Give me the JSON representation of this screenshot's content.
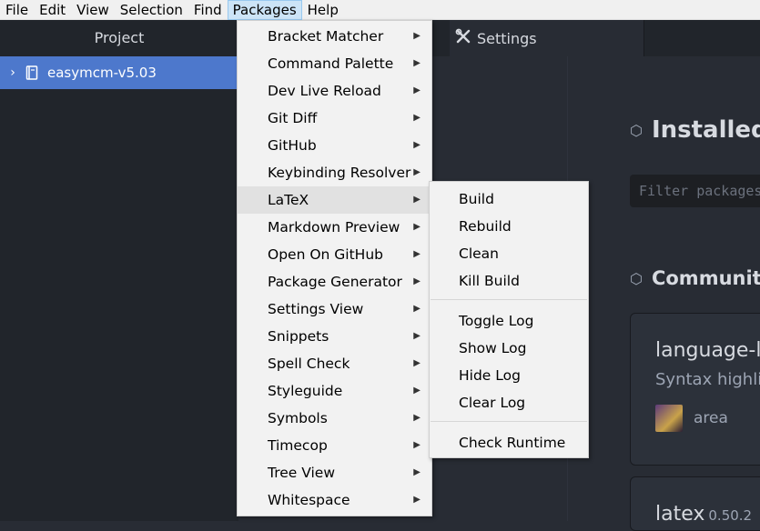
{
  "menubar": {
    "items": [
      "File",
      "Edit",
      "View",
      "Selection",
      "Find",
      "Packages",
      "Help"
    ],
    "active": "Packages"
  },
  "tree": {
    "header": "Project",
    "root_label": "easymcm-v5.03"
  },
  "tabs": {
    "settings_label": "Settings"
  },
  "settings": {
    "installed_title": "Installed",
    "filter_placeholder": "Filter packages",
    "community_title": "Community",
    "card1": {
      "name": "language-la",
      "desc": "Syntax highlig",
      "author": "area"
    },
    "card2": {
      "name": "latex",
      "version": "0.50.2"
    }
  },
  "packages_menu": {
    "items": [
      "Bracket Matcher",
      "Command Palette",
      "Dev Live Reload",
      "Git Diff",
      "GitHub",
      "Keybinding Resolver",
      "LaTeX",
      "Markdown Preview",
      "Open On GitHub",
      "Package Generator",
      "Settings View",
      "Snippets",
      "Spell Check",
      "Styleguide",
      "Symbols",
      "Timecop",
      "Tree View",
      "Whitespace"
    ],
    "highlighted": "LaTeX"
  },
  "latex_menu": {
    "group1": [
      "Build",
      "Rebuild",
      "Clean",
      "Kill Build"
    ],
    "group2": [
      "Toggle Log",
      "Show Log",
      "Hide Log",
      "Clear Log"
    ],
    "group3": [
      "Check Runtime"
    ]
  },
  "colors": {
    "accent": "#4d78cc",
    "menu_bg": "#f2f2f2",
    "editor_bg": "#282c34",
    "panel_bg": "#21252b"
  },
  "icons": {
    "arrow": "submenu-arrow-icon",
    "gear": "tools-icon",
    "package": "package-icon"
  }
}
